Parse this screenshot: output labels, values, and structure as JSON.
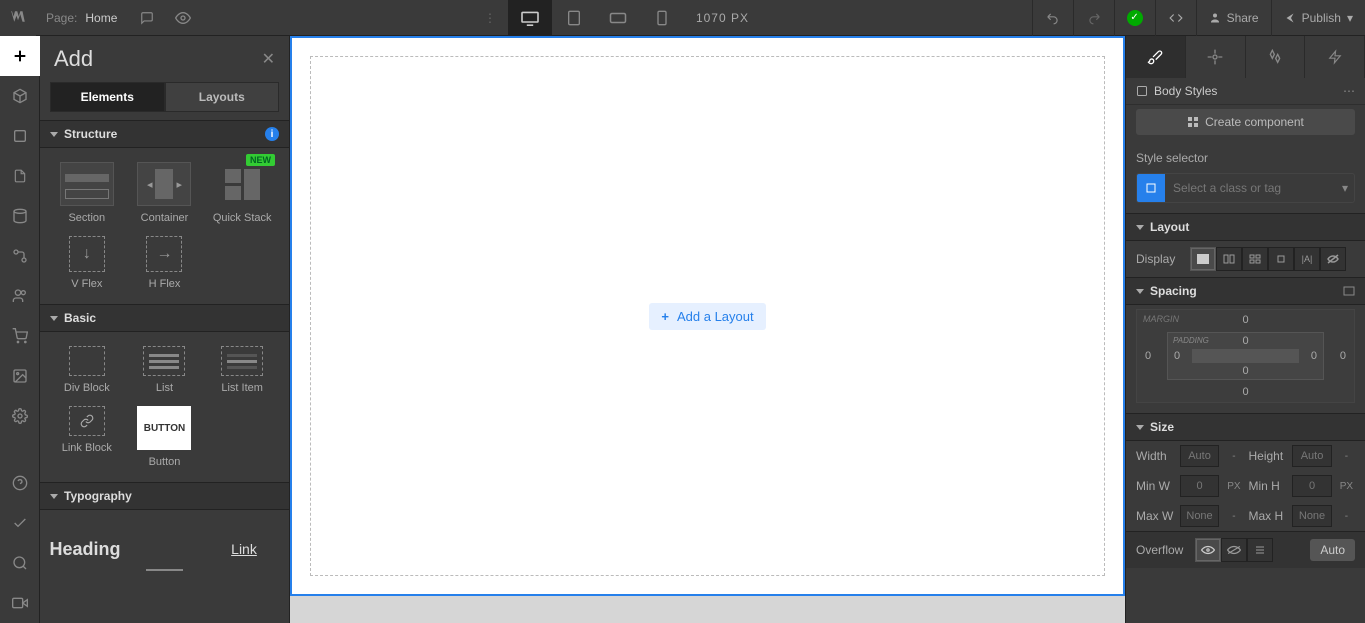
{
  "topbar": {
    "page_label": "Page:",
    "page_name": "Home",
    "canvas_width": "1070 PX",
    "share": "Share",
    "publish": "Publish"
  },
  "add_panel": {
    "title": "Add",
    "tab_elements": "Elements",
    "tab_layouts": "Layouts",
    "sec_structure": "Structure",
    "sec_basic": "Basic",
    "sec_typography": "Typography",
    "items": {
      "section": "Section",
      "container": "Container",
      "quickstack": "Quick Stack",
      "new": "NEW",
      "vflex": "V Flex",
      "hflex": "H Flex",
      "divblock": "Div Block",
      "list": "List",
      "listitem": "List Item",
      "linkblock": "Link Block",
      "button": "Button",
      "button_text": "BUTTON",
      "heading": "Heading",
      "link": "Link"
    }
  },
  "canvas": {
    "add_layout": "Add a Layout"
  },
  "style_panel": {
    "body_styles": "Body Styles",
    "create_component": "Create component",
    "style_selector": "Style selector",
    "select_class": "Select a class or tag",
    "layout": "Layout",
    "display": "Display",
    "spacing": "Spacing",
    "margin": "MARGIN",
    "padding": "PADDING",
    "margin_top": "0",
    "margin_right": "0",
    "margin_bottom": "0",
    "margin_left": "0",
    "padding_top": "0",
    "padding_right": "0",
    "padding_bottom": "0",
    "padding_left": "0",
    "size": "Size",
    "width": "Width",
    "height": "Height",
    "minw": "Min W",
    "minh": "Min H",
    "maxw": "Max W",
    "maxh": "Max H",
    "auto": "Auto",
    "zero": "0",
    "none": "None",
    "px": "PX",
    "dash": "-",
    "overflow": "Overflow",
    "auto_btn": "Auto"
  }
}
